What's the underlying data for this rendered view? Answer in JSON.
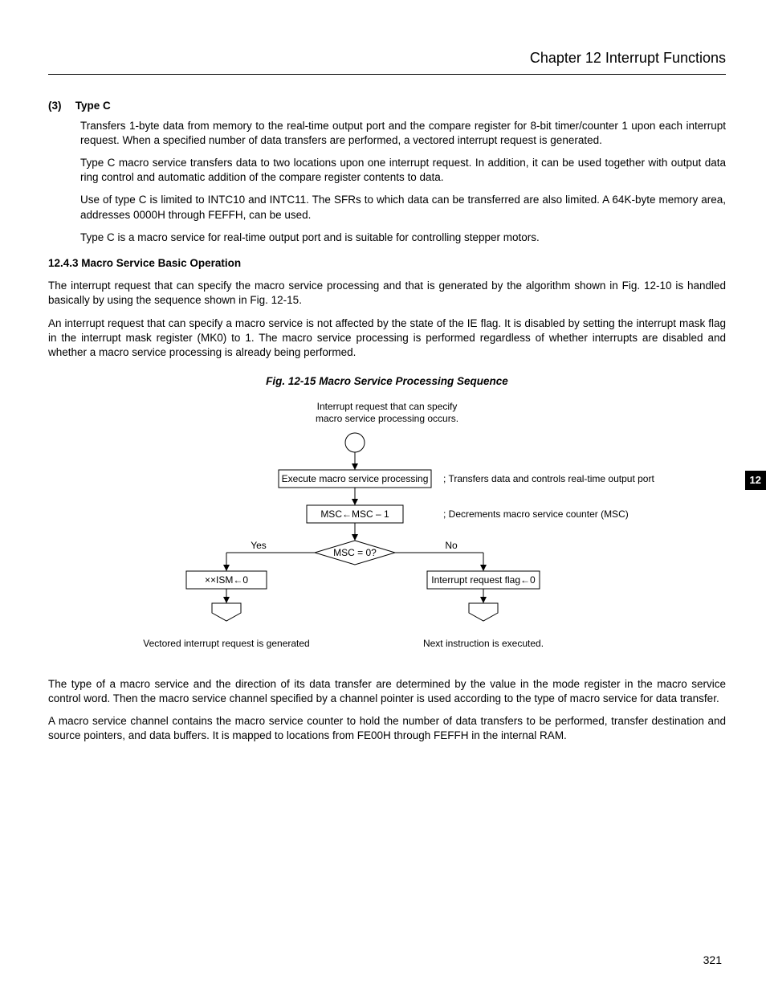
{
  "chapter_header": "Chapter 12   Interrupt Functions",
  "side_tab": "12",
  "page_num": "321",
  "sec3": {
    "num": "(3)",
    "title": "Type C",
    "p1": "Transfers 1-byte data from memory to the real-time output port and the compare register for 8-bit timer/counter 1 upon each interrupt request.  When a specified number of data transfers are performed, a vectored interrupt request is generated.",
    "p2": "Type C macro service transfers data to two locations upon one interrupt request.  In addition, it can be used together with output data ring control and automatic addition of the compare register contents to data.",
    "p3": "Use of type C is limited to INTC10 and INTC11.  The SFRs to which data can be transferred are also limited.  A 64K-byte memory area, addresses 0000H through FEFFH, can be used.",
    "p4": "Type C is a macro service for real-time output port and is suitable for controlling stepper motors."
  },
  "sec1243": {
    "title": "12.4.3  Macro Service Basic Operation",
    "p1": "The interrupt request that can specify the macro service processing and that is generated by the algorithm shown in Fig. 12-10 is handled basically by using the sequence shown in Fig. 12-15.",
    "p2": "An interrupt request that can specify a macro service is not affected by the state of the IE flag.  It is disabled by setting the interrupt mask flag in the interrupt mask register (MK0) to 1.  The macro service processing is performed regardless of whether interrupts are disabled and whether a macro service processing is already being performed."
  },
  "fig": {
    "caption": "Fig. 12-15  Macro Service Processing Sequence",
    "top_line1": "Interrupt request that can specify",
    "top_line2": "macro service processing occurs.",
    "box1": "Execute macro service processing",
    "box1_note": "; Transfers data and controls real-time output port",
    "box2": "MSC←MSC – 1",
    "box2_note": "; Decrements macro service counter (MSC)",
    "decision": "MSC = 0?",
    "yes": "Yes",
    "no": "No",
    "left_box": "××ISM←0",
    "right_box": "Interrupt request flag←0",
    "left_end": "Vectored interrupt request is generated",
    "right_end": "Next instruction is executed."
  },
  "after": {
    "p1": "The type of a macro service and the direction of its data transfer are determined by the value in the mode register in the macro service control word.  Then the macro service channel specified by a channel pointer is used according to the type of macro service for data transfer.",
    "p2": "A macro service channel contains the macro service counter to hold the number of data transfers to be performed, transfer destination and source pointers, and data buffers.  It is mapped to locations from FE00H through FEFFH in the internal RAM."
  }
}
